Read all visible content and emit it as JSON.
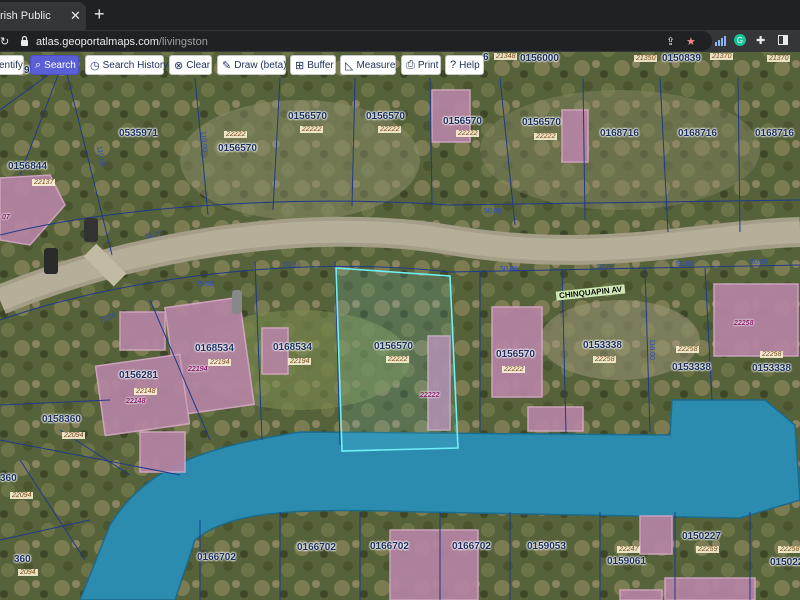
{
  "browser": {
    "tab_title": "rish Public",
    "tab_close": "✕",
    "new_tab": "+",
    "url_domain": "atlas.geoportalmaps.com",
    "url_path": "/livingston"
  },
  "tools": {
    "identify": "entify",
    "search": "Search",
    "history": "Search History",
    "clear": "Clear",
    "draw": "Draw (beta)",
    "buffer": "Buffer",
    "measure": "Measure",
    "print": "Print",
    "help": "Help"
  },
  "parcels": {
    "p1": "0535971",
    "p2": "0156570",
    "p3": "0156570",
    "p4": "0156570",
    "p5": "0156570",
    "p6": "0156570",
    "p7": "0168716",
    "p8": "0168716",
    "p9": "0168716",
    "p10": "0156844",
    "p11": "0156000",
    "p12": "0150839",
    "p13": "0168534",
    "p14": "0168534",
    "p15": "0156570",
    "p16": "0156570",
    "p17": "0153338",
    "p18": "0153338",
    "p19": "0153338",
    "p20": "0156281",
    "p21": "0158360",
    "p22": "360",
    "p23": "0166702",
    "p24": "0166702",
    "p25": "0166702",
    "p26": "0166702",
    "p27": "0159053",
    "p28": "0150227",
    "p29": "0159061",
    "p30": "0150227",
    "p31": "360",
    "p32": "9",
    "p33": "6"
  },
  "addresses": {
    "a1": "22222",
    "a2": "22222",
    "a3": "22222",
    "a4": "22222",
    "a5": "22222",
    "a6": "22137",
    "a7": "22194",
    "a8": "22194",
    "a9": "22194",
    "a10": "22222",
    "a11": "22222",
    "a12": "22222",
    "a13": "22258",
    "a14": "22258",
    "a15": "22258",
    "a16": "22258",
    "a17": "22148",
    "a18": "22148",
    "a19": "22094",
    "a20": "22094",
    "a21": "22247",
    "a22": "22259",
    "a23": "22258",
    "a24": "21348",
    "a25": "21350",
    "a26": "21370",
    "a27": "21370",
    "a28": "2094",
    "a29": "07",
    "a30": "22222"
  },
  "street_label": "CHINQUAPIN AV",
  "dimensions": {
    "d1": "53.00",
    "d2": "50.00",
    "d3": "75.00",
    "d4": "50.30",
    "d5": "50.00",
    "d6": "50.00",
    "d7": "50.00",
    "d8": "110.00",
    "d9": "110.00",
    "d10": "110.00",
    "d11": "75.00",
    "d12": "50.00"
  },
  "logo_text": "T"
}
